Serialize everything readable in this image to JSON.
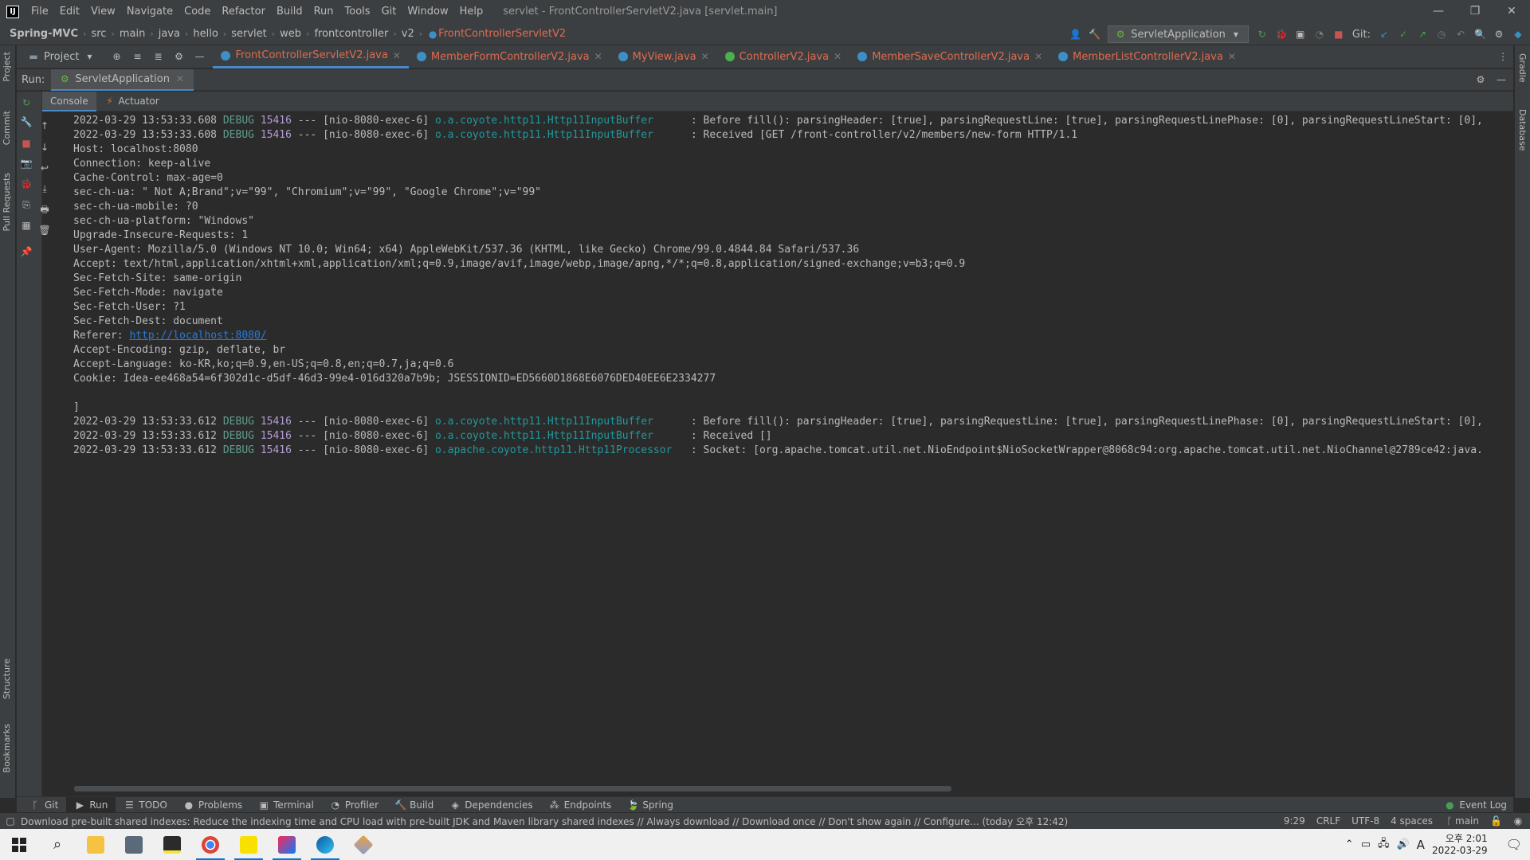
{
  "app": {
    "logo": "IJ",
    "menu": [
      "File",
      "Edit",
      "View",
      "Navigate",
      "Code",
      "Refactor",
      "Build",
      "Run",
      "Tools",
      "Git",
      "Window",
      "Help"
    ],
    "title": "servlet - FrontControllerServletV2.java [servlet.main]",
    "window_controls": [
      "—",
      "❐",
      "✕"
    ]
  },
  "breadcrumbs": [
    "Spring-MVC",
    "src",
    "main",
    "java",
    "hello",
    "servlet",
    "web",
    "frontcontroller",
    "v2",
    "FrontControllerServletV2"
  ],
  "toolbar": {
    "run_config": "ServletApplication",
    "git_label": "Git:"
  },
  "project_selector": "Project",
  "editor_tabs": [
    {
      "label": "FrontControllerServletV2.java",
      "icon_color": "#3d8fc5",
      "active": true
    },
    {
      "label": "MemberFormControllerV2.java",
      "icon_color": "#3d8fc5",
      "active": false
    },
    {
      "label": "MyView.java",
      "icon_color": "#3d8fc5",
      "active": false
    },
    {
      "label": "ControllerV2.java",
      "icon_color": "#4caf50",
      "active": false
    },
    {
      "label": "MemberSaveControllerV2.java",
      "icon_color": "#3d8fc5",
      "active": false
    },
    {
      "label": "MemberListControllerV2.java",
      "icon_color": "#3d8fc5",
      "active": false
    }
  ],
  "run_panel": {
    "label": "Run:",
    "tab": "ServletApplication",
    "subtabs": [
      "Console",
      "Actuator"
    ]
  },
  "left_stripe": [
    "Project",
    "Commit",
    "Pull Requests",
    "Structure",
    "Bookmarks"
  ],
  "right_stripe": [
    "Gradle",
    "Database"
  ],
  "console": {
    "lines": [
      {
        "ts": "2022-03-29 13:53:33.608",
        "level": "DEBUG",
        "pid": "15416",
        "sep": " --- [nio-8080-exec-6] ",
        "logger": "o.a.coyote.http11.Http11InputBuffer     ",
        "msg": " : Before fill(): parsingHeader: [true], parsingRequestLine: [true], parsingRequestLinePhase: [0], parsingRequestLineStart: [0],"
      },
      {
        "ts": "2022-03-29 13:53:33.608",
        "level": "DEBUG",
        "pid": "15416",
        "sep": " --- [nio-8080-exec-6] ",
        "logger": "o.a.coyote.http11.Http11InputBuffer     ",
        "msg": " : Received [GET /front-controller/v2/members/new-form HTTP/1.1"
      },
      {
        "text": "Host: localhost:8080"
      },
      {
        "text": "Connection: keep-alive"
      },
      {
        "text": "Cache-Control: max-age=0"
      },
      {
        "text": "sec-ch-ua: \" Not A;Brand\";v=\"99\", \"Chromium\";v=\"99\", \"Google Chrome\";v=\"99\""
      },
      {
        "text": "sec-ch-ua-mobile: ?0"
      },
      {
        "text": "sec-ch-ua-platform: \"Windows\""
      },
      {
        "text": "Upgrade-Insecure-Requests: 1"
      },
      {
        "text": "User-Agent: Mozilla/5.0 (Windows NT 10.0; Win64; x64) AppleWebKit/537.36 (KHTML, like Gecko) Chrome/99.0.4844.84 Safari/537.36"
      },
      {
        "text": "Accept: text/html,application/xhtml+xml,application/xml;q=0.9,image/avif,image/webp,image/apng,*/*;q=0.8,application/signed-exchange;v=b3;q=0.9"
      },
      {
        "text": "Sec-Fetch-Site: same-origin"
      },
      {
        "text": "Sec-Fetch-Mode: navigate"
      },
      {
        "text": "Sec-Fetch-User: ?1"
      },
      {
        "text": "Sec-Fetch-Dest: document"
      },
      {
        "prefix": "Referer: ",
        "link": "http://localhost:8080/"
      },
      {
        "text": "Accept-Encoding: gzip, deflate, br"
      },
      {
        "text": "Accept-Language: ko-KR,ko;q=0.9,en-US;q=0.8,en;q=0.7,ja;q=0.6"
      },
      {
        "text": "Cookie: Idea-ee468a54=6f302d1c-d5df-46d3-99e4-016d320a7b9b; JSESSIONID=ED5660D1868E6076DED40EE6E2334277"
      },
      {
        "text": ""
      },
      {
        "text": "]"
      },
      {
        "ts": "2022-03-29 13:53:33.612",
        "level": "DEBUG",
        "pid": "15416",
        "sep": " --- [nio-8080-exec-6] ",
        "logger": "o.a.coyote.http11.Http11InputBuffer     ",
        "msg": " : Before fill(): parsingHeader: [true], parsingRequestLine: [true], parsingRequestLinePhase: [0], parsingRequestLineStart: [0],"
      },
      {
        "ts": "2022-03-29 13:53:33.612",
        "level": "DEBUG",
        "pid": "15416",
        "sep": " --- [nio-8080-exec-6] ",
        "logger": "o.a.coyote.http11.Http11InputBuffer     ",
        "msg": " : Received []"
      },
      {
        "ts": "2022-03-29 13:53:33.612",
        "level": "DEBUG",
        "pid": "15416",
        "sep": " --- [nio-8080-exec-6] ",
        "logger": "o.apache.coyote.http11.Http11Processor  ",
        "msg": " : Socket: [org.apache.tomcat.util.net.NioEndpoint$NioSocketWrapper@8068c94:org.apache.tomcat.util.net.NioChannel@2789ce42:java."
      }
    ]
  },
  "bottom_tools": [
    "Git",
    "Run",
    "TODO",
    "Problems",
    "Terminal",
    "Profiler",
    "Build",
    "Dependencies",
    "Endpoints",
    "Spring"
  ],
  "event_log": "Event Log",
  "status": {
    "message": "Download pre-built shared indexes: Reduce the indexing time and CPU load with pre-built JDK and Maven library shared indexes // Always download // Download once // Don't show again // Configure... (today 오후 12:42)",
    "position": "9:29",
    "line_sep": "CRLF",
    "encoding": "UTF-8",
    "indent": "4 spaces",
    "branch": "main"
  },
  "taskbar": {
    "time": "오후 2:01",
    "date": "2022-03-29",
    "ime": "A"
  }
}
